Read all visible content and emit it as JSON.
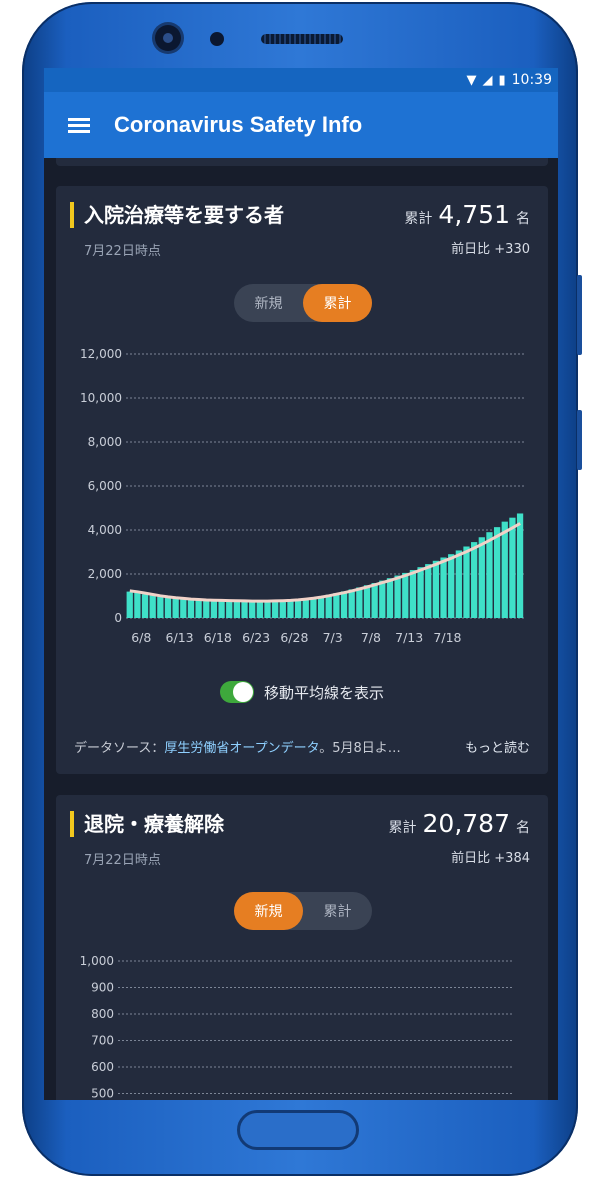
{
  "status_bar": {
    "time": "10:39"
  },
  "app_bar": {
    "title": "Coronavirus Safety Info"
  },
  "card1": {
    "title": "入院治療等を要する者",
    "date": "7月22日時点",
    "total_label": "累計",
    "total_value": "4,751",
    "total_unit": "名",
    "diff": "前日比 +330",
    "seg_new": "新規",
    "seg_cum": "累計",
    "toggle_label": "移動平均線を表示",
    "source_prefix": "データソース：",
    "source_link": "厚生労働省オープンデータ",
    "source_suffix": "。5月8日よ…",
    "more": "もっと読む"
  },
  "card2": {
    "title": "退院・療養解除",
    "date": "7月22日時点",
    "total_label": "累計",
    "total_value": "20,787",
    "total_unit": "名",
    "diff": "前日比 +384",
    "seg_new": "新規",
    "seg_cum": "累計"
  },
  "colors": {
    "bar": "#3fe0c8",
    "moving_average": "#f1d2c8",
    "accent": "#e67e22",
    "appbar": "#1e72d3"
  },
  "chart_data": [
    {
      "type": "bar",
      "series": [
        {
          "name": "",
          "values": [
            1200,
            1150,
            1080,
            1020,
            970,
            930,
            900,
            880,
            860,
            840,
            830,
            820,
            810,
            800,
            790,
            780,
            780,
            770,
            770,
            780,
            790,
            810,
            840,
            880,
            930,
            990,
            1060,
            1130,
            1210,
            1300,
            1390,
            1490,
            1590,
            1700,
            1810,
            1930,
            2050,
            2180,
            2310,
            2450,
            2600,
            2750,
            2900,
            3070,
            3250,
            3450,
            3670,
            3900,
            4130,
            4380,
            4560,
            4751
          ]
        }
      ],
      "moving_average": [
        1230,
        1190,
        1130,
        1070,
        1010,
        960,
        920,
        890,
        860,
        840,
        820,
        810,
        800,
        790,
        780,
        775,
        770,
        770,
        770,
        775,
        785,
        800,
        825,
        860,
        900,
        950,
        1010,
        1080,
        1150,
        1230,
        1320,
        1410,
        1510,
        1610,
        1710,
        1820,
        1930,
        2050,
        2180,
        2310,
        2440,
        2580,
        2720,
        2870,
        3020,
        3180,
        3350,
        3530,
        3720,
        3910,
        4100,
        4300
      ],
      "x_ticks": [
        "6/8",
        "6/13",
        "6/18",
        "6/23",
        "6/28",
        "7/3",
        "7/8",
        "7/13",
        "7/18"
      ],
      "y_ticks": [
        "0",
        "2,000",
        "4,000",
        "6,000",
        "8,000",
        "10,000",
        "12,000"
      ],
      "ylim": [
        0,
        12000
      ],
      "grid": true
    },
    {
      "type": "bar",
      "series": [],
      "y_ticks": [
        "500",
        "600",
        "700",
        "800",
        "900",
        "1,000"
      ],
      "ylim": [
        500,
        1000
      ],
      "grid": true
    }
  ]
}
